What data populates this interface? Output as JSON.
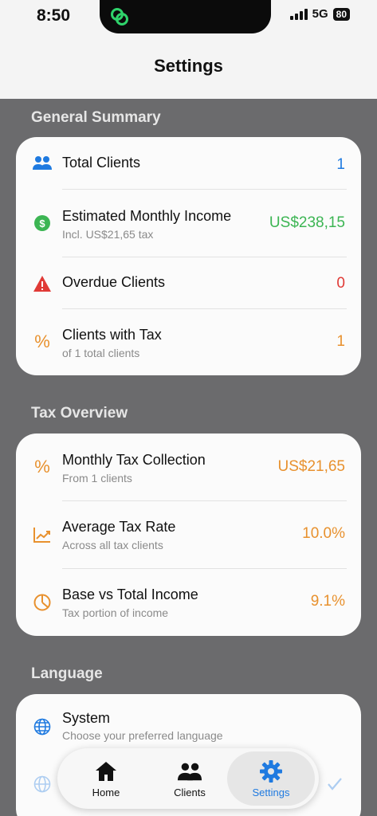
{
  "status_bar": {
    "time": "8:50",
    "network": "5G",
    "battery": "80"
  },
  "header": {
    "title": "Settings"
  },
  "general_summary": {
    "title": "General Summary",
    "rows": [
      {
        "label": "Total Clients",
        "sub": "",
        "value": "1",
        "icon": "people-icon",
        "color": "#1f7ae0"
      },
      {
        "label": "Estimated Monthly Income",
        "sub": "Incl. US$21,65 tax",
        "value": "US$238,15",
        "icon": "dollar-icon",
        "color": "#3cb553"
      },
      {
        "label": "Overdue Clients",
        "sub": "",
        "value": "0",
        "icon": "warning-icon",
        "color": "#e03a36"
      },
      {
        "label": "Clients with Tax",
        "sub": "of 1 total clients",
        "value": "1",
        "icon": "percent-icon",
        "color": "#e8912e"
      }
    ]
  },
  "tax_overview": {
    "title": "Tax Overview",
    "rows": [
      {
        "label": "Monthly Tax Collection",
        "sub": "From 1 clients",
        "value": "US$21,65",
        "icon": "percent-icon",
        "color": "#e8912e"
      },
      {
        "label": "Average Tax Rate",
        "sub": "Across all tax clients",
        "value": "10.0%",
        "icon": "trend-chart-icon",
        "color": "#e8912e"
      },
      {
        "label": "Base vs Total Income",
        "sub": "Tax portion of income",
        "value": "9.1%",
        "icon": "pie-chart-icon",
        "color": "#e8912e"
      }
    ]
  },
  "language": {
    "title": "Language",
    "rows": [
      {
        "label": "System",
        "sub": "Choose your preferred language"
      }
    ]
  },
  "tab_bar": {
    "tabs": [
      {
        "label": "Home",
        "icon": "house-icon",
        "active": false
      },
      {
        "label": "Clients",
        "icon": "people-icon",
        "active": false
      },
      {
        "label": "Settings",
        "icon": "gear-icon",
        "active": true
      }
    ]
  }
}
